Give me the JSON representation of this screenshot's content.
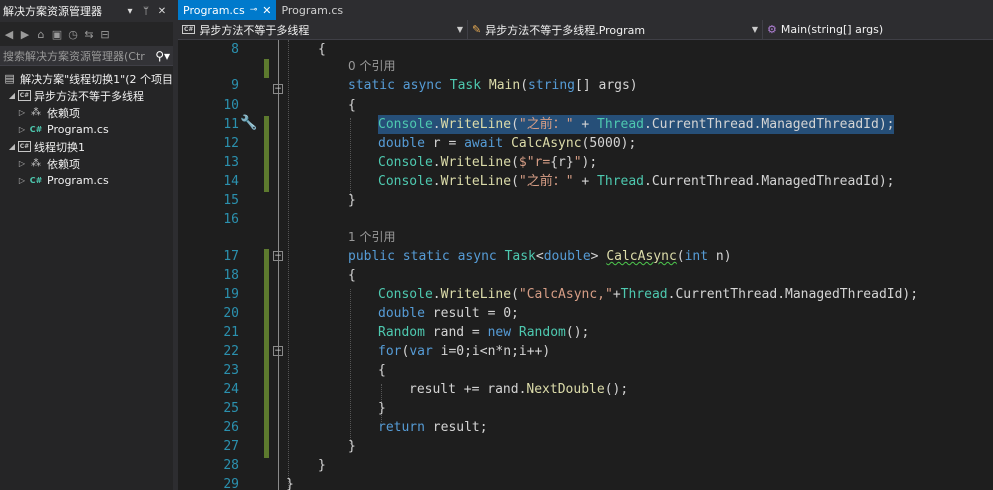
{
  "solution_explorer": {
    "title": "解决方案资源管理器",
    "title_controls": [
      "▾",
      "ᛘ",
      "✕"
    ],
    "search_placeholder": "搜索解决方案资源管理器(Ctr",
    "tree": [
      {
        "label": "解决方案\"线程切换1\"(2 个项目",
        "icon": "solution-icon"
      },
      {
        "label": "异步方法不等于多线程",
        "icon": "csharp-project-icon"
      },
      {
        "label": "依赖项",
        "icon": "dependencies-icon"
      },
      {
        "label": "Program.cs",
        "icon": "csharp-file-icon"
      },
      {
        "label": "线程切换1",
        "icon": "csharp-project-icon"
      },
      {
        "label": "依赖项",
        "icon": "dependencies-icon"
      },
      {
        "label": "Program.cs",
        "icon": "csharp-file-icon"
      }
    ]
  },
  "tabs": [
    {
      "label": "Program.cs",
      "active": true
    },
    {
      "label": "Program.cs",
      "active": false
    }
  ],
  "navbar": {
    "project": "异步方法不等于多线程",
    "class": "异步方法不等于多线程.Program",
    "member": "Main(string[] args)"
  },
  "code": {
    "line_numbers": [
      "8",
      "9",
      "10",
      "11",
      "12",
      "13",
      "14",
      "15",
      "16",
      "17",
      "18",
      "19",
      "20",
      "21",
      "22",
      "23",
      "24",
      "25",
      "26",
      "27",
      "28",
      "29"
    ],
    "ref_main": "0 个引用",
    "ref_calc": "1 个引用"
  },
  "colors": {
    "accent": "#007acc",
    "keyword": "#569cd6",
    "type": "#4ec9b0",
    "string": "#d69d85",
    "method": "#dcdcaa",
    "line_number": "#2b91af",
    "selection": "#264f78"
  }
}
